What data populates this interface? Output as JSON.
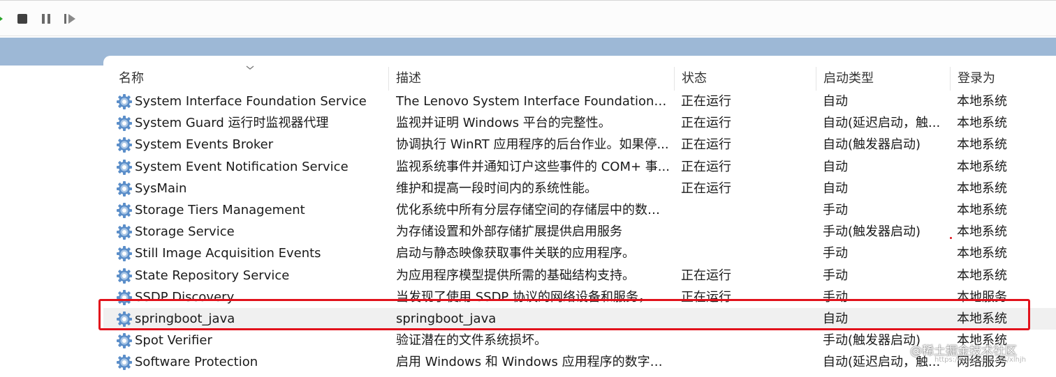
{
  "toolbar": {
    "icons": [
      "play-icon",
      "stop-icon",
      "pause-icon",
      "restart-icon"
    ]
  },
  "columns": {
    "name": "名称",
    "description": "描述",
    "status": "状态",
    "startup_type": "启动类型",
    "log_on_as": "登录为"
  },
  "services": [
    {
      "name": "System Interface Foundation Service",
      "description": "The Lenovo System Interface Foundation Servi...",
      "status": "正在运行",
      "startup": "自动",
      "logon": "本地系统"
    },
    {
      "name": "System Guard 运行时监视器代理",
      "description": "监视并证明 Windows 平台的完整性。",
      "status": "正在运行",
      "startup": "自动(延迟启动，触...",
      "logon": "本地系统"
    },
    {
      "name": "System Events Broker",
      "description": "协调执行 WinRT 应用程序的后台作业。如果停...",
      "status": "正在运行",
      "startup": "自动(触发器启动)",
      "logon": "本地系统"
    },
    {
      "name": "System Event Notification Service",
      "description": "监视系统事件并通知订户这些事件的 COM+ 事...",
      "status": "正在运行",
      "startup": "自动",
      "logon": "本地系统"
    },
    {
      "name": "SysMain",
      "description": "维护和提高一段时间内的系统性能。",
      "status": "正在运行",
      "startup": "自动",
      "logon": "本地系统"
    },
    {
      "name": "Storage Tiers Management",
      "description": "优化系统中所有分层存储空间的存储层中的数据...",
      "status": "",
      "startup": "手动",
      "logon": "本地系统"
    },
    {
      "name": "Storage Service",
      "description": "为存储设置和外部存储扩展提供启用服务",
      "status": "",
      "startup": "手动(触发器启动)",
      "logon": "本地系统"
    },
    {
      "name": "Still Image Acquisition Events",
      "description": "启动与静态映像获取事件关联的应用程序。",
      "status": "",
      "startup": "手动",
      "logon": "本地系统"
    },
    {
      "name": "State Repository Service",
      "description": "为应用程序模型提供所需的基础结构支持。",
      "status": "正在运行",
      "startup": "手动",
      "logon": "本地系统"
    },
    {
      "name": "SSDP Discovery",
      "description": "当发现了使用 SSDP 协议的网络设备和服务，如...",
      "status": "正在运行",
      "startup": "手动",
      "logon": "本地服务"
    },
    {
      "name": "springboot_java",
      "description": "springboot_java",
      "status": "",
      "startup": "自动",
      "logon": "本地系统"
    },
    {
      "name": "Spot Verifier",
      "description": "验证潜在的文件系统损坏。",
      "status": "",
      "startup": "手动(触发器启动)",
      "logon": "本地系统"
    },
    {
      "name": "Software Protection",
      "description": "启用 Windows 和 Windows 应用程序的数字许...",
      "status": "",
      "startup": "自动(延迟启动，触...",
      "logon": "网络服务"
    }
  ],
  "selected_service": "springboot_java",
  "watermark": "@稀土掘金技术社区",
  "watermark_url": "https://blog.csdn.net/xlhjh",
  "colors": {
    "band": "#9db8d6",
    "highlight": "#e2121c",
    "selected_row": "#f0f0f0"
  }
}
